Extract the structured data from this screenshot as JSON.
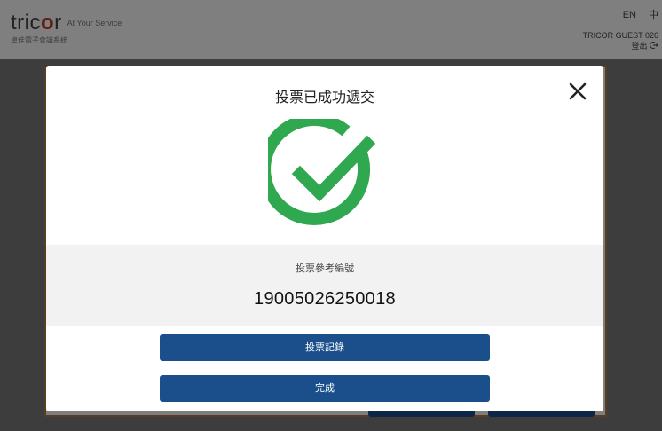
{
  "header": {
    "logo_word_pre": "tric",
    "logo_word_o": "o",
    "logo_word_post": "r",
    "logo_tagline": "At Your Service",
    "logo_subtitle": "卓佳電子會議系統",
    "lang_en": "EN",
    "lang_zh": "中",
    "user_name": "TRICOR GUEST 026",
    "logout_label": "登出"
  },
  "modal": {
    "title": "投票已成功遞交",
    "reference_label": "投票參考編號",
    "reference_number": "19005026250018",
    "voting_record_button": "投票記錄",
    "done_button": "完成"
  },
  "colors": {
    "success_green": "#2fa84f",
    "primary_blue": "#1b4f8c",
    "brand_red": "#c0392b"
  },
  "icons": {
    "close": "close-icon",
    "success": "checkmark-circle-icon",
    "logout": "logout-icon"
  }
}
